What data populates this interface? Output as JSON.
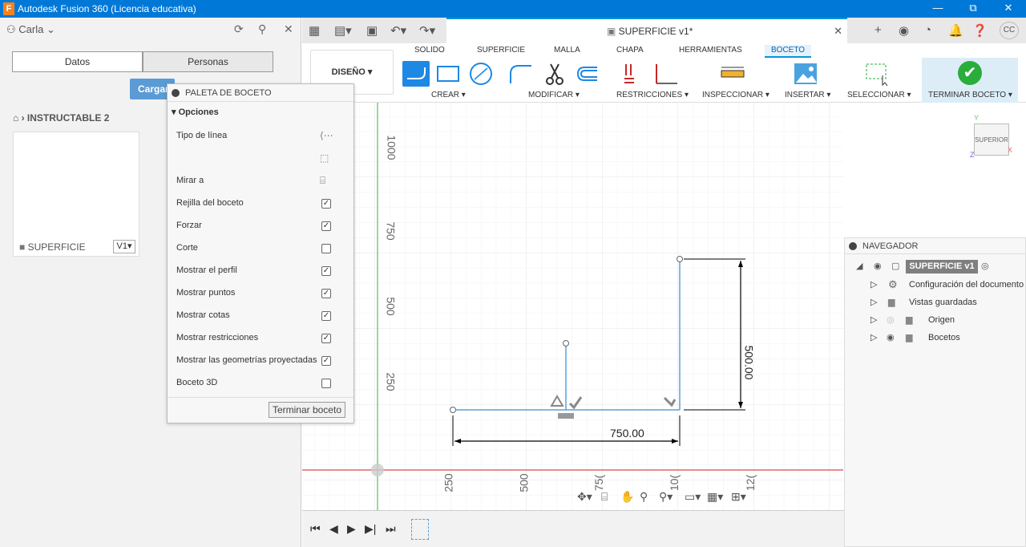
{
  "window": {
    "title": "Autodesk Fusion 360 (Licencia educativa)",
    "logo": "F",
    "controls": [
      "—",
      "⧉",
      "✕"
    ]
  },
  "left": {
    "user": "Carla",
    "segments": [
      "Datos",
      "Personas"
    ],
    "upload": "Cargar",
    "breadcrumb": "INSTRUCTABLE 2",
    "card_label": "SUPERFICIE",
    "card_version": "V1"
  },
  "doc": {
    "tab_title": "SUPERFICIE v1*",
    "user_initials": "CC"
  },
  "ribbon": {
    "tabs": [
      "SOLIDO",
      "SUPERFICIE",
      "MALLA",
      "CHAPA",
      "HERRAMIENTAS",
      "BOCETO"
    ],
    "workspace": "DISEÑO",
    "groups": [
      "CREAR",
      "MODIFICAR",
      "RESTRICCIONES",
      "INSPECCIONAR",
      "INSERTAR",
      "SELECCIONAR"
    ],
    "finish": "TERMINAR BOCETO"
  },
  "palette": {
    "title": "PALETA DE BOCETO",
    "section": "Opciones",
    "rows": [
      {
        "label": "Tipo de línea",
        "control": "icon"
      },
      {
        "label": "",
        "control": "icon"
      },
      {
        "label": "Mirar a",
        "control": "icon"
      },
      {
        "label": "Rejilla del boceto",
        "checked": true
      },
      {
        "label": "Forzar",
        "checked": true
      },
      {
        "label": "Corte",
        "checked": false
      },
      {
        "label": "Mostrar el perfil",
        "checked": true
      },
      {
        "label": "Mostrar puntos",
        "checked": true
      },
      {
        "label": "Mostrar cotas",
        "checked": true
      },
      {
        "label": "Mostrar restricciones",
        "checked": true
      },
      {
        "label": "Mostrar las geometrías proyectadas",
        "checked": true
      },
      {
        "label": "Boceto 3D",
        "checked": false
      }
    ],
    "finish": "Terminar boceto"
  },
  "canvas": {
    "v_ticks": [
      "1000",
      "750",
      "500",
      "250"
    ],
    "h_ticks": [
      "250",
      "500",
      "75(",
      "10(",
      "12("
    ],
    "dim_h": "750.00",
    "dim_v": "500.00",
    "viewcube": {
      "face": "SUPERIOR",
      "axis_y": "Y",
      "axis_x": "X",
      "axis_z": "Z"
    }
  },
  "navigator": {
    "title": "NAVEGADOR",
    "root": "SUPERFICIE v1",
    "items": [
      "Configuración del documento",
      "Vistas guardadas",
      "Origen",
      "Bocetos"
    ]
  },
  "colors": {
    "titlebar": "#0078d7",
    "accent": "#0696d7",
    "sketch_line": "#5aa0d8",
    "finish_green": "#2aad3b",
    "axis_red": "#e06666",
    "axis_green": "#7cc97c"
  }
}
